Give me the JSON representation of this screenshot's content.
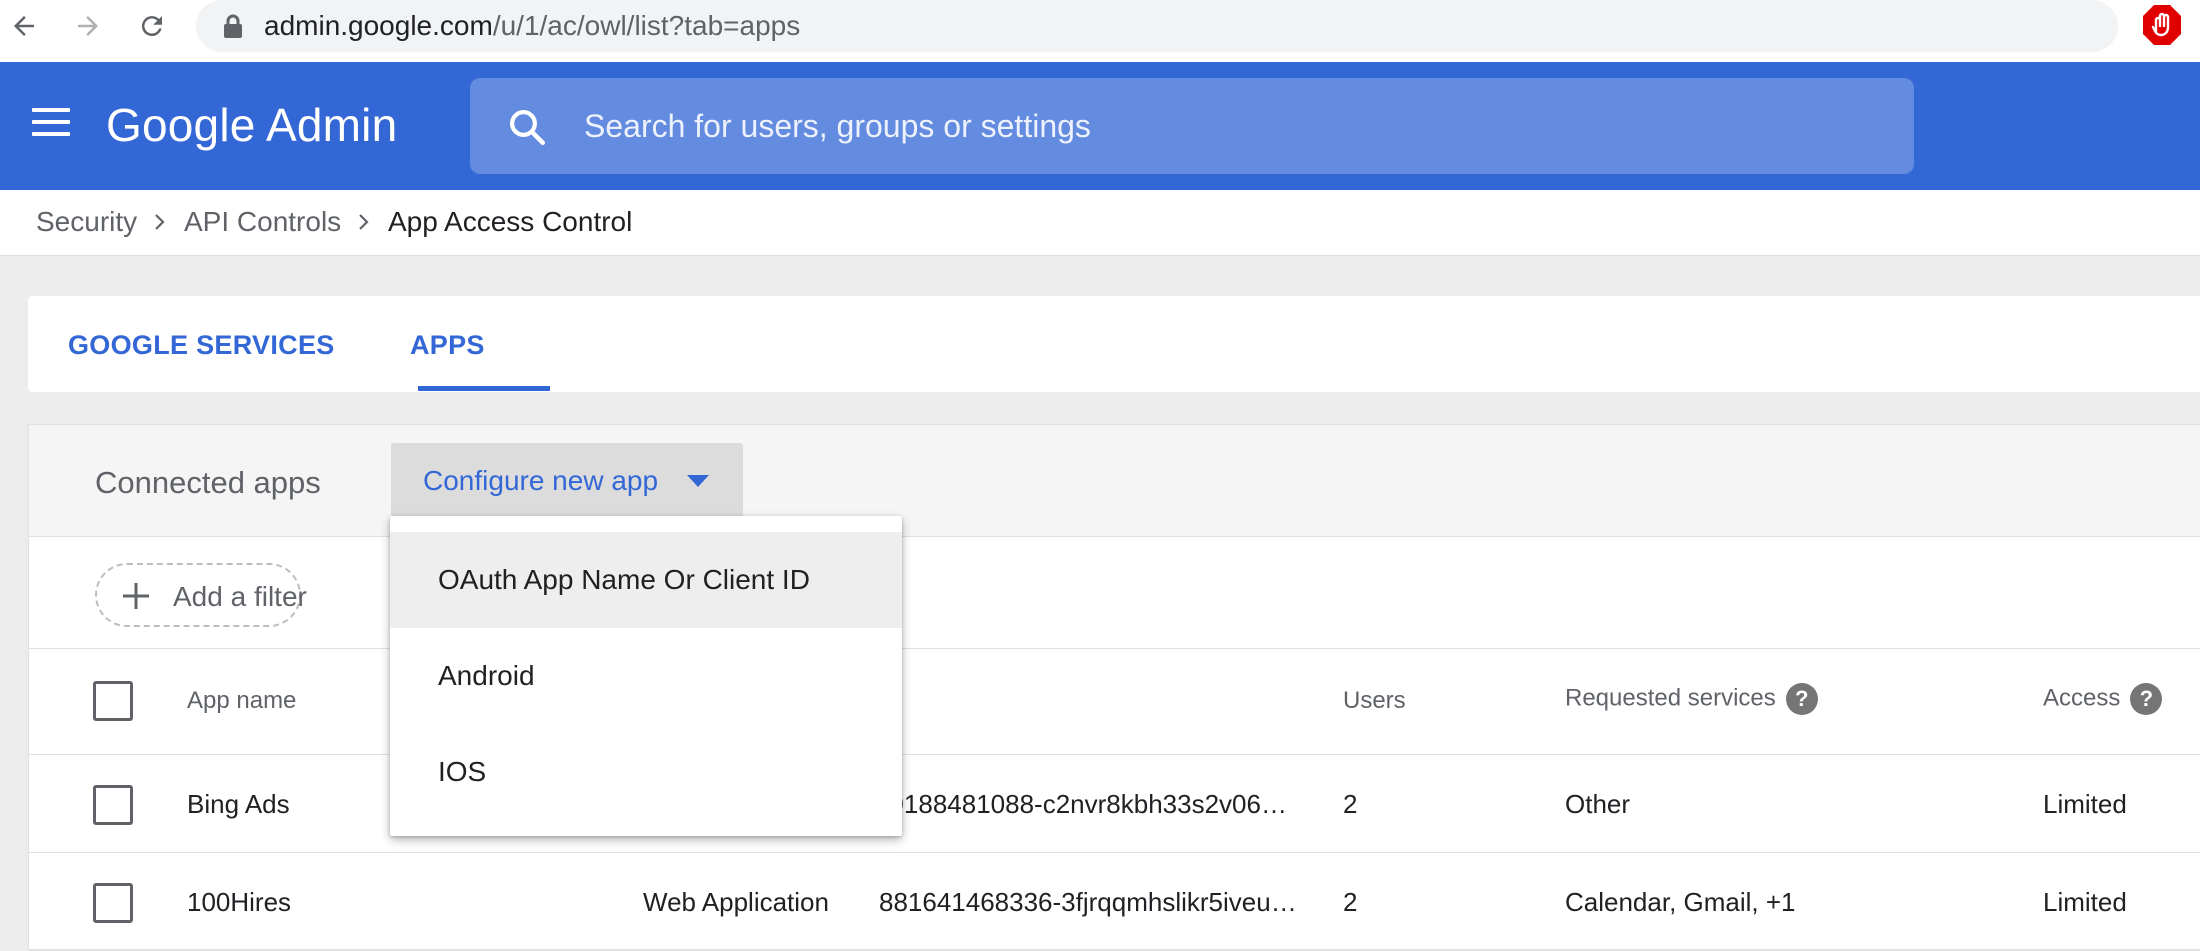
{
  "browser": {
    "url_host": "admin.google.com",
    "url_path": "/u/1/ac/owl/list?tab=apps"
  },
  "header": {
    "brand_google": "Google",
    "brand_admin": "Admin",
    "search_placeholder": "Search for users, groups or settings"
  },
  "breadcrumb": [
    "Security",
    "API Controls",
    "App Access Control"
  ],
  "tabs": [
    {
      "label": "GOOGLE SERVICES",
      "active": false
    },
    {
      "label": "APPS",
      "active": true
    }
  ],
  "card": {
    "title": "Connected apps",
    "configure_label": "Configure new app",
    "filter_label": "Add a filter"
  },
  "dropdown": {
    "items": [
      "OAuth App Name Or Client ID",
      "Android",
      "IOS"
    ],
    "highlighted_index": 0
  },
  "table": {
    "columns": {
      "app_name": "App name",
      "users": "Users",
      "requested_services": "Requested services",
      "access": "Access"
    },
    "rows": [
      {
        "app_name": "Bing Ads",
        "type": "",
        "client_id": "39188481088-c2nvr8kbh33s2v06…",
        "users": "2",
        "services": "Other",
        "access": "Limited"
      },
      {
        "app_name": "100Hires",
        "type": "Web Application",
        "client_id": "881641468336-3fjrqqmhslikr5iveu…",
        "users": "2",
        "services": "Calendar, Gmail, +1",
        "access": "Limited"
      }
    ]
  },
  "colors": {
    "brand_blue": "#3367d6",
    "extension_red": "#e00000"
  }
}
